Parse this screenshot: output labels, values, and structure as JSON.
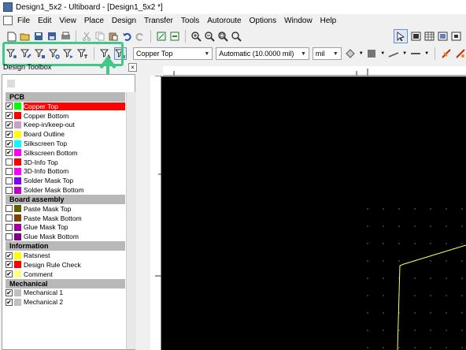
{
  "window": {
    "title": "Design1_5x2 - Ultiboard - [Design1_5x2 *]"
  },
  "menu": [
    "File",
    "Edit",
    "View",
    "Place",
    "Design",
    "Transfer",
    "Tools",
    "Autoroute",
    "Options",
    "Window",
    "Help"
  ],
  "toolbar2": {
    "layer_select": "Copper Top",
    "grid_select": "Automatic (10.0000 mil)",
    "unit_select": "mil"
  },
  "toolbox": {
    "title": "Design Toolbox",
    "close_glyph": "×",
    "groups": [
      {
        "name": "PCB",
        "items": [
          {
            "label": "Copper Top",
            "checked": true,
            "color": "#00ff00",
            "selected": true
          },
          {
            "label": "Copper Bottom",
            "checked": true,
            "color": "#ff0000"
          },
          {
            "label": "Keep-in/keep-out",
            "checked": true,
            "color": "#c8a0c8"
          },
          {
            "label": "Board Outline",
            "checked": true,
            "color": "#ffff00"
          },
          {
            "label": "Silkscreen Top",
            "checked": true,
            "color": "#00ffff"
          },
          {
            "label": "Silkscreen Bottom",
            "checked": true,
            "color": "#ff00ff"
          },
          {
            "label": "3D-Info Top",
            "checked": false,
            "color": "#ff0000"
          },
          {
            "label": "3D-Info Bottom",
            "checked": false,
            "color": "#ff00ff"
          },
          {
            "label": "Solder Mask Top",
            "checked": false,
            "color": "#8000ff"
          },
          {
            "label": "Solder Mask Bottom",
            "checked": false,
            "color": "#c000c0"
          }
        ]
      },
      {
        "name": "Board assembly",
        "items": [
          {
            "label": "Paste Mask Top",
            "checked": false,
            "color": "#606000"
          },
          {
            "label": "Paste Mask Bottom",
            "checked": false,
            "color": "#804000"
          },
          {
            "label": "Glue Mask Top",
            "checked": false,
            "color": "#a000a0"
          },
          {
            "label": "Glue Mask Bottom",
            "checked": false,
            "color": "#800080"
          }
        ]
      },
      {
        "name": "Information",
        "items": [
          {
            "label": "Ratsnest",
            "checked": true,
            "color": "#ffff00"
          },
          {
            "label": "Design Rule Check",
            "checked": true,
            "color": "#ff0000"
          },
          {
            "label": "Comment",
            "checked": true,
            "color": "#ffff80"
          }
        ]
      },
      {
        "name": "Mechanical",
        "items": [
          {
            "label": "Mechanical 1",
            "checked": true,
            "color": "#c0c0c0"
          },
          {
            "label": "Mechanical 2",
            "checked": true,
            "color": "#c0c0c0"
          }
        ]
      }
    ]
  },
  "colors": {
    "highlight": "#3ec98a",
    "canvas": "#000000",
    "board_outline": "#ffff66"
  }
}
